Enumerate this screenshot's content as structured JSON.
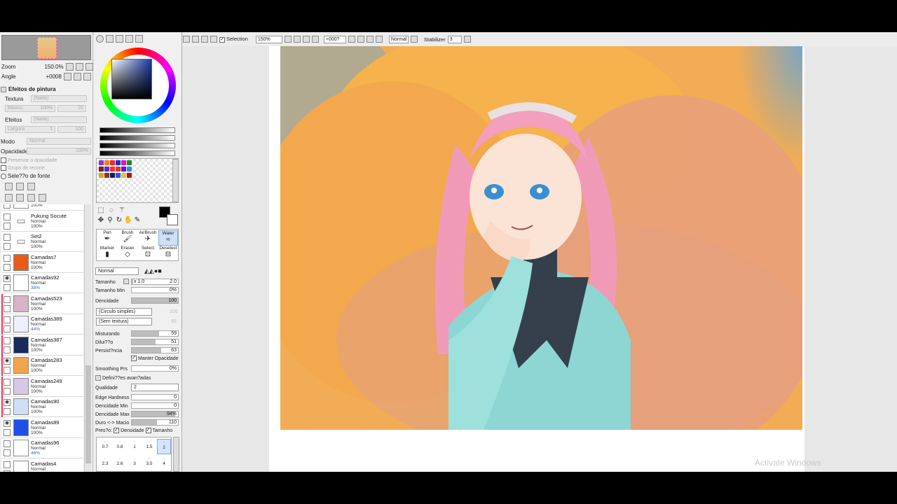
{
  "navigator": {
    "zoom_label": "Zoom",
    "zoom_value": "150.0%",
    "angle_label": "Angle",
    "angle_value": "+0008"
  },
  "paint_effects": {
    "title": "Efeitos de pintura",
    "texture_label": "Textura",
    "texture_value": "(Nada)",
    "texture_sub_label": "Básico",
    "texture_sub_value": "100%",
    "texture_sub_num": "20",
    "effects_label": "Efeitos",
    "effects_value": "(Nada)",
    "effects_sub_label": "Largura",
    "effects_sub_num1": "1",
    "effects_sub_num2": "100"
  },
  "layer_props": {
    "mode_label": "Modo",
    "mode_value": "Normal",
    "opacity_label": "Opacidade",
    "opacity_value": "100%",
    "preserve_opacity": "Preservar a opacidade",
    "clip_group": "Grupo de recorte",
    "source_selection": "Sele??o de fonte"
  },
  "layers": [
    {
      "name": "",
      "mode": "",
      "opacity": "100%",
      "visible": false,
      "kind": "blank",
      "clip": false,
      "thumb": "#ffffff"
    },
    {
      "name": "Pukung Socute",
      "mode": "Normal",
      "opacity": "100%",
      "visible": false,
      "kind": "folder",
      "clip": false,
      "thumb": "#ffffff"
    },
    {
      "name": "Set2",
      "mode": "Normal",
      "opacity": "100%",
      "visible": false,
      "kind": "folder",
      "clip": false,
      "thumb": "#ffffff"
    },
    {
      "name": "Camadas7",
      "mode": "Normal",
      "opacity": "100%",
      "visible": false,
      "kind": "layer",
      "clip": false,
      "thumb": "#e85a1a"
    },
    {
      "name": "Camadas92",
      "mode": "Normal",
      "opacity": "38%",
      "visible": true,
      "kind": "layer",
      "clip": false,
      "thumb": "#ffffff"
    },
    {
      "name": "Camadas523",
      "mode": "Normal",
      "opacity": "100%",
      "visible": false,
      "kind": "layer",
      "clip": true,
      "thumb": "#d9b3c8"
    },
    {
      "name": "Camadas389",
      "mode": "Normal",
      "opacity": "44%",
      "visible": false,
      "kind": "layer",
      "clip": true,
      "thumb": "#eef0ff"
    },
    {
      "name": "Camadas387",
      "mode": "Normal",
      "opacity": "100%",
      "visible": false,
      "kind": "layer",
      "clip": true,
      "thumb": "#1a2a5a"
    },
    {
      "name": "Camadas283",
      "mode": "Normal",
      "opacity": "100%",
      "visible": true,
      "kind": "layer",
      "clip": true,
      "thumb": "#f2a44a"
    },
    {
      "name": "Camadas249",
      "mode": "Normal",
      "opacity": "100%",
      "visible": false,
      "kind": "layer",
      "clip": true,
      "thumb": "#d8c8e8"
    },
    {
      "name": "Camadas90",
      "mode": "Normal",
      "opacity": "100%",
      "visible": true,
      "kind": "layer",
      "clip": true,
      "thumb": "#cfe0f5"
    },
    {
      "name": "Camadas89",
      "mode": "Normal",
      "opacity": "100%",
      "visible": true,
      "kind": "layer",
      "clip": false,
      "thumb": "#1e4fe8"
    },
    {
      "name": "Camadas96",
      "mode": "Normal",
      "opacity": "46%",
      "visible": false,
      "kind": "layer",
      "clip": false,
      "thumb": "#ffffff"
    },
    {
      "name": "Camadas4",
      "mode": "Normal",
      "opacity": "",
      "visible": false,
      "kind": "layer",
      "clip": false,
      "thumb": "#ffffff"
    }
  ],
  "colors": {
    "primary": "#000000",
    "secondary": "#ffffff",
    "swatches": [
      "#7a3fd8",
      "#ff7a1a",
      "#e23030",
      "#2a2ad8",
      "#d81ab8",
      "#1a8a2a",
      "#8a1a1a",
      "#3a3ad8",
      "#ff3030",
      "#d83a3a",
      "#5a1ad8",
      "#3a8ad8",
      "#d8a81a",
      "#8a3a1a",
      "#1a1a5a",
      "#2a5ad8",
      "#f0c030",
      "#a81a1a"
    ]
  },
  "tools": {
    "brushes": [
      {
        "name": "Pen",
        "icon": "pen-icon"
      },
      {
        "name": "Brush",
        "icon": "brush-icon"
      },
      {
        "name": "AirBrush",
        "icon": "airbrush-icon"
      },
      {
        "name": "Water",
        "icon": "water-brush-icon"
      },
      {
        "name": "Marker",
        "icon": "marker-icon"
      },
      {
        "name": "Eraser",
        "icon": "eraser-icon"
      },
      {
        "name": "Select",
        "icon": "select-brush-icon"
      },
      {
        "name": "Deselect",
        "icon": "deselect-icon"
      }
    ],
    "selected_brush": "Water",
    "blend_mode": "Normal",
    "size_label": "Tamanho",
    "size_multiplier": "x 1.0",
    "size_value": "2.0",
    "min_size_label": "Tamanho Min",
    "min_size_value": "0%",
    "density_label": "Dencidade",
    "density_value": "100",
    "shape_value": "(Circulo simples)",
    "shape_num": "100",
    "texture_value": "(Sem textura)",
    "texture_num": "95",
    "blending_label": "Misturando",
    "blending_value": "59",
    "dilution_label": "Dilui??o",
    "dilution_value": "51",
    "persistence_label": "Persist?ncia",
    "persistence_value": "63",
    "keep_opacity": "Manter Opacidade",
    "smoothing_label": "Smoothing Prs",
    "smoothing_value": "0%",
    "advanced_title": "Defini??es avan?adas",
    "quality_label": "Qualidade",
    "quality_value": "2",
    "edge_label": "Edge Hardness",
    "edge_value": "0",
    "min_density_label": "Dencidade Min",
    "min_density_value": "0",
    "max_density_label": "Dencidade Max",
    "max_density_value": "94%",
    "hard_soft_label": "Duro <-> Macio",
    "hard_soft_value": "110",
    "pressure_label": "Pres?o:",
    "pressure_density": "Densidade",
    "pressure_size": "Tamanho",
    "size_presets_row1": [
      "0.7",
      "0.8",
      "1",
      "1.5",
      "2"
    ],
    "size_presets_row2": [
      "2.3",
      "2.6",
      "3",
      "3.5",
      "4"
    ],
    "selected_preset": "2"
  },
  "toolbar": {
    "selection_label": "Selection",
    "zoom_value": "150%",
    "angle_value": "+000?",
    "mode_value": "Normal",
    "stabilizer_label": "Stabilizer",
    "stabilizer_value": "3"
  },
  "watermark": "Activate Windows"
}
